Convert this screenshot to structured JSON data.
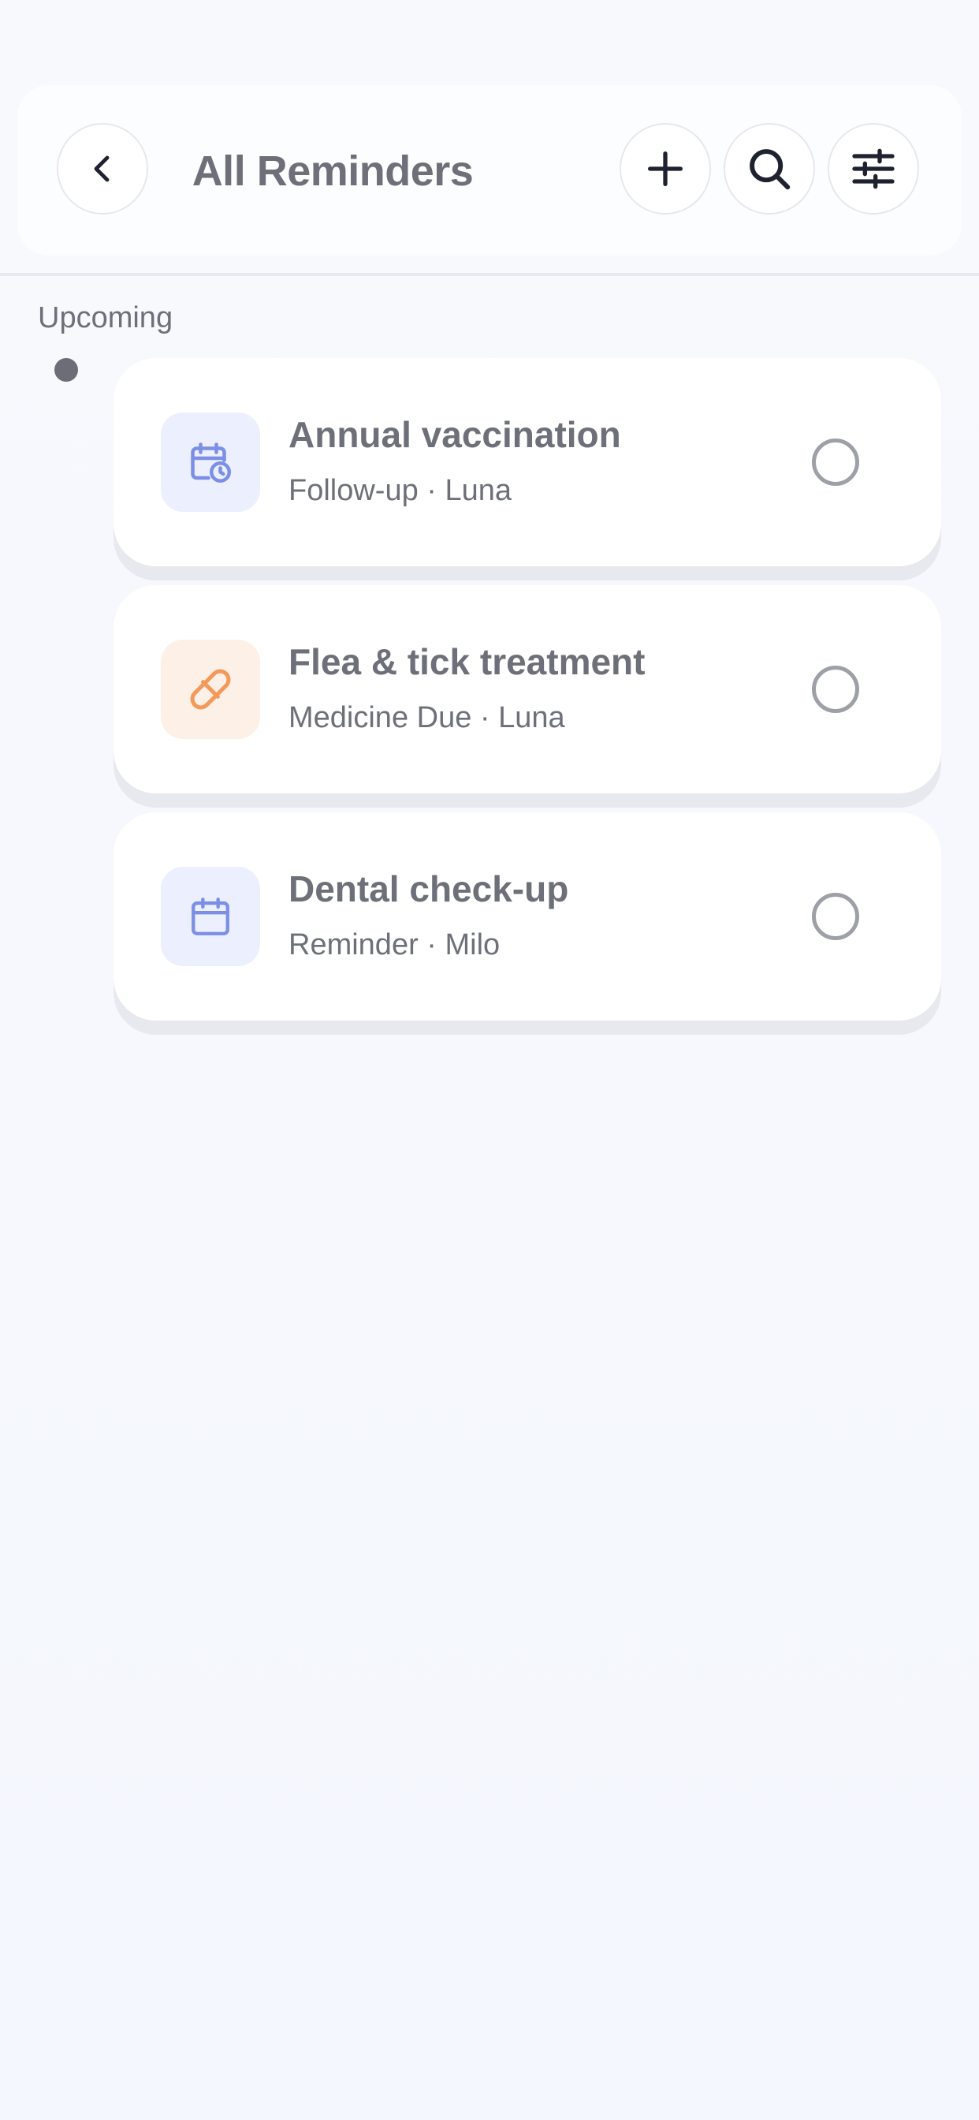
{
  "header": {
    "title": "All Reminders",
    "back_icon": "chevron-left-icon",
    "add_icon": "plus-icon",
    "search_icon": "search-icon",
    "filter_icon": "sliders-icon"
  },
  "section": {
    "label": "Upcoming"
  },
  "reminders": [
    {
      "title": "Annual vaccination",
      "subtitle": "Follow-up · Luna",
      "icon": "calendar-clock-icon",
      "icon_color": "#7b8fe6",
      "icon_bg": "#eceffd",
      "completed": false
    },
    {
      "title": "Flea & tick treatment",
      "subtitle": "Medicine Due · Luna",
      "icon": "pill-icon",
      "icon_color": "#f39a5a",
      "icon_bg": "#fdf0e7",
      "completed": false
    },
    {
      "title": "Dental check-up",
      "subtitle": "Reminder · Milo",
      "icon": "calendar-icon",
      "icon_color": "#7b8fe6",
      "icon_bg": "#eceffd",
      "completed": false
    }
  ],
  "colors": {
    "background": "#f6f8fd",
    "text": "#6d7079",
    "accent_blue": "#7b8fe6",
    "accent_orange": "#f39a5a"
  }
}
